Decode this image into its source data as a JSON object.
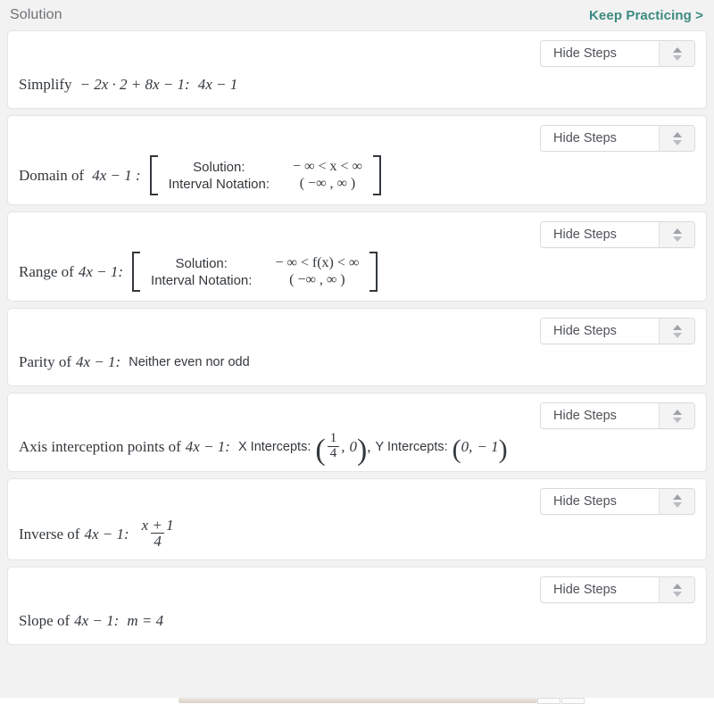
{
  "header": {
    "title": "Solution",
    "keep_practicing_label": "Keep Practicing >",
    "accent_color": "#3c8a80",
    "title_color": "#6e7176"
  },
  "toolbar": {
    "hide_steps_label": "Hide Steps",
    "spinner_up_icon": "triangle-up-icon",
    "spinner_down_icon": "triangle-down-icon"
  },
  "page": {
    "background_color": "#f2f2f2",
    "card_background_color": "#ffffff",
    "card_border_color": "#e4e4e4"
  },
  "expression": "4x − 1",
  "cards": [
    {
      "id": "simplify",
      "kind": "inline",
      "label": "Simplify",
      "problem": "− 2x · 2 + 8x − 1:",
      "result": "4x − 1"
    },
    {
      "id": "domain",
      "kind": "matrix",
      "label": "Domain of",
      "expression": "4x − 1 :",
      "rows": [
        {
          "key": "Solution:",
          "value": "− ∞ < x < ∞"
        },
        {
          "key": "Interval Notation:",
          "value": "( −∞ , ∞ )"
        }
      ]
    },
    {
      "id": "range",
      "kind": "matrix",
      "label": "Range of",
      "expression": "4x − 1:",
      "rows": [
        {
          "key": "Solution:",
          "value": "− ∞ < f(x) < ∞"
        },
        {
          "key": "Interval Notation:",
          "value": "( −∞ , ∞ )"
        }
      ]
    },
    {
      "id": "parity",
      "kind": "inline",
      "label": "Parity of",
      "problem": "4x − 1:",
      "result": "Neither even nor odd"
    },
    {
      "id": "intercepts",
      "kind": "intercepts",
      "label": "Axis interception points of",
      "problem": "4x − 1:",
      "x_intercepts_label": "X Intercepts:",
      "x_intercept": {
        "numerator": "1",
        "denominator": "4",
        "second": "0"
      },
      "separator": ",",
      "y_intercepts_label": "Y Intercepts:",
      "y_intercept": {
        "first": "0",
        "second": "− 1"
      }
    },
    {
      "id": "inverse",
      "kind": "fraction",
      "label": "Inverse of",
      "problem": "4x − 1:",
      "numerator": "x + 1",
      "denominator": "4"
    },
    {
      "id": "slope",
      "kind": "inline",
      "label": "Slope of",
      "problem": "4x − 1:",
      "result": "m = 4"
    }
  ]
}
